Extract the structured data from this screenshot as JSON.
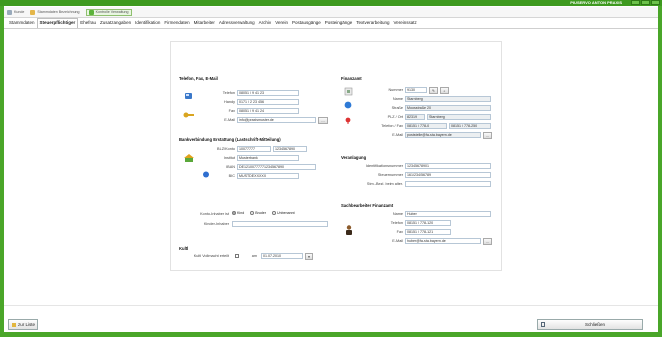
{
  "window": {
    "title": "PIUSERVO ANTON PRAXIS"
  },
  "quickbar": {
    "items": [
      {
        "label": "Kunde"
      },
      {
        "label": "Stammdaten Bezeichnung"
      },
      {
        "label": "Kontrolle Verwaltung"
      }
    ]
  },
  "tabs": [
    {
      "label": "Stammdaten"
    },
    {
      "label": "Steuerpflichtiger"
    },
    {
      "label": "Ehefrau"
    },
    {
      "label": "Zusatzangaben"
    },
    {
      "label": "Identifikation"
    },
    {
      "label": "Firmendaten"
    },
    {
      "label": "Mitarbeiter"
    },
    {
      "label": "Adressverwaltung"
    },
    {
      "label": "Archiv"
    },
    {
      "label": "Verein"
    },
    {
      "label": "Postausgänge"
    },
    {
      "label": "Posteingänge"
    },
    {
      "label": "Textverarbeitung"
    },
    {
      "label": "Vereinssatz"
    }
  ],
  "left": {
    "contact": {
      "title": "Telefon, Fax, E-Mail",
      "fields": [
        {
          "label": "Telefon",
          "value": "08051 / 9 41 23"
        },
        {
          "label": "Handy",
          "value": "0171 / 2 23 456"
        },
        {
          "label": "Fax",
          "value": "08051 / 9 41 24"
        },
        {
          "label": "E-Mail",
          "value": "info@praxismuster.de"
        }
      ]
    },
    "bank": {
      "title": "Bankverbindung Erstattung (Lastschrift-Mitteilung)",
      "fields": [
        {
          "label": "BLZ/Konto",
          "value": "10077777",
          "value2": "1234567890"
        },
        {
          "label": "Institut",
          "value": "Musterbank"
        },
        {
          "label": "IBAN",
          "value": "DE12100777771234567890"
        },
        {
          "label": "BIC",
          "value": "MUSTDEXXXXX"
        }
      ]
    },
    "abweichend": {
      "label": "Konto-Inhaber ist",
      "options": [
        "Kind",
        "Bruder",
        "Unbenannt"
      ],
      "selected": 0,
      "kind_label": "Kinder-Inhaber",
      "kind_value": ""
    },
    "gebot": {
      "title": "Kultl",
      "label": "Kultl Vollmacht erteilt",
      "am_label": "am",
      "date": "01.07.2010"
    }
  },
  "right": {
    "finanzamt": {
      "title": "Finanzamt",
      "fields": [
        {
          "label": "Nummer",
          "value": "9130"
        },
        {
          "label": "Name",
          "value": "Starnberg"
        },
        {
          "label": "Straße",
          "value": "Moosstraße 20"
        },
        {
          "label": "PLZ / Ort",
          "value": "82319",
          "value2": "Starnberg"
        },
        {
          "label": "Telefon / Fax",
          "value": "08151 / 778-0",
          "value2": "08151 / 778-250"
        },
        {
          "label": "E-Mail",
          "value": "poststelle@fa-sta.bayern.de"
        }
      ]
    },
    "veranlagung": {
      "title": "Veranlagung",
      "fields": [
        {
          "label": "Identifikationsnummer",
          "value": "12345678901"
        },
        {
          "label": "Steuernummer",
          "value": "161/234/56789"
        },
        {
          "label": "Stm.-Bezl. beim alter.",
          "value": ""
        }
      ]
    },
    "berater": {
      "title": "Sachbearbeiter Finanzamt",
      "fields": [
        {
          "label": "Name",
          "value": "Huber"
        },
        {
          "label": "Telefon",
          "value": "08151 / 778-120"
        },
        {
          "label": "Fax",
          "value": "08151 / 778-121"
        },
        {
          "label": "E-Mail",
          "value": "huber@fa-sta.bayern.de"
        }
      ]
    }
  },
  "bottom": {
    "left_button": "zur Liste",
    "close_button": "Schließen"
  },
  "colors": {
    "accent": "#4aa629",
    "titlebar": "#3e9a1f"
  }
}
